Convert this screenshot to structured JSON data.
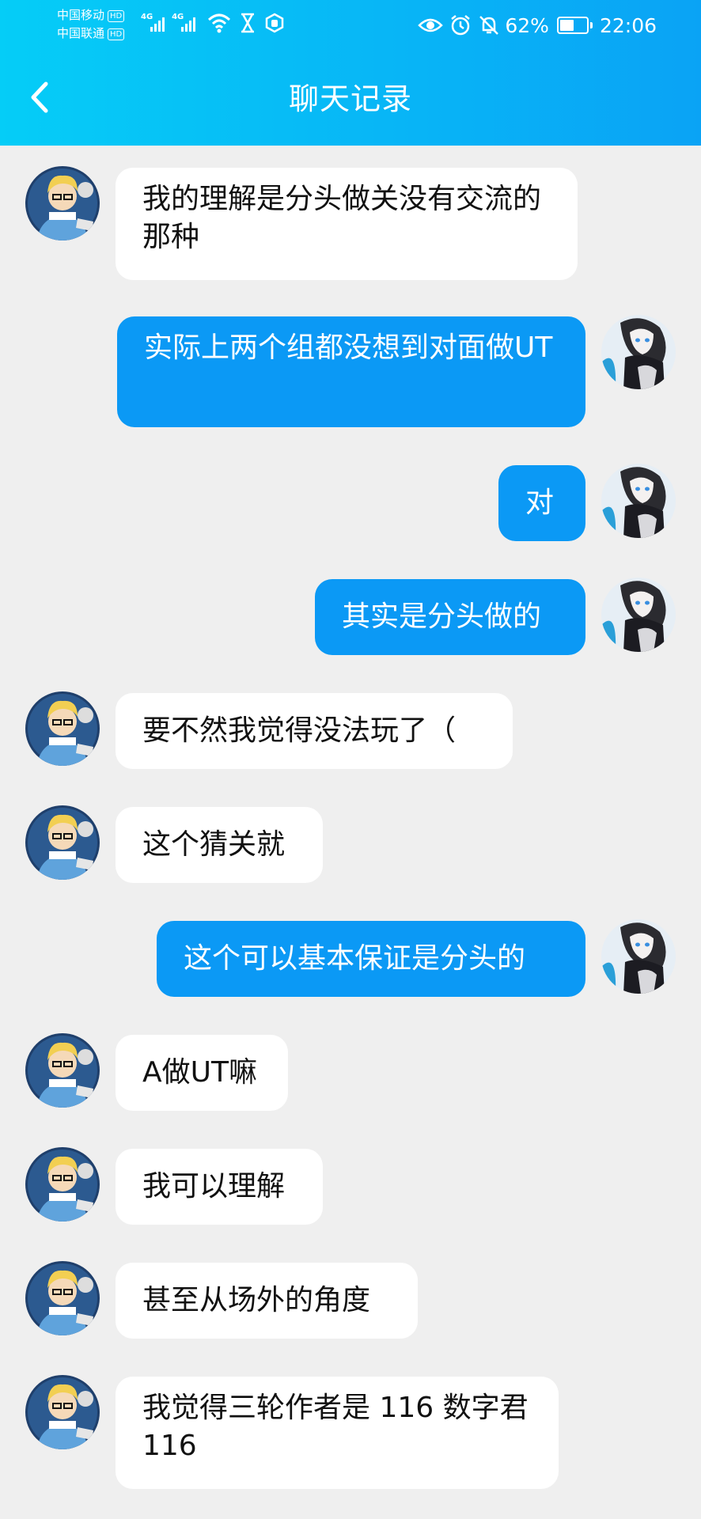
{
  "status_bar": {
    "carrier_1": "中国移动",
    "carrier_2": "中国联通",
    "hd_badge": "HD",
    "network_1": "4G",
    "network_2": "4G",
    "battery_percent": "62%",
    "battery_level": 0.62,
    "time": "22:06"
  },
  "header": {
    "title": "聊天记录",
    "back_icon": "chevron-left-icon",
    "gradient": [
      "#05cdf7",
      "#0aa3f5"
    ]
  },
  "colors": {
    "incoming_bubble": "#ffffff",
    "outgoing_bubble": "#0b99f5",
    "background": "#efefef"
  },
  "messages": [
    {
      "side": "incoming",
      "text": "我的理解是分头做关没有交流的那种"
    },
    {
      "side": "outgoing",
      "text": "实际上两个组都没想到对面做UT"
    },
    {
      "side": "outgoing",
      "text": "对"
    },
    {
      "side": "outgoing",
      "text": "其实是分头做的"
    },
    {
      "side": "incoming",
      "text": "要不然我觉得没法玩了（"
    },
    {
      "side": "incoming",
      "text": "这个猜关就"
    },
    {
      "side": "outgoing",
      "text": "这个可以基本保证是分头的"
    },
    {
      "side": "incoming",
      "text": "A做UT嘛"
    },
    {
      "side": "incoming",
      "text": "我可以理解"
    },
    {
      "side": "incoming",
      "text": "甚至从场外的角度"
    },
    {
      "side": "incoming",
      "text": "我觉得三轮作者是 116 数字君 116"
    }
  ]
}
